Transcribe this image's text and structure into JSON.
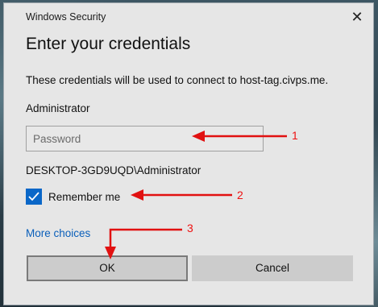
{
  "window": {
    "title": "Windows Security",
    "close_glyph": "✕"
  },
  "dialog": {
    "heading": "Enter your credentials",
    "info": "These credentials will be used to connect to host-tag.civps.me.",
    "username": "Administrator",
    "password_placeholder": "Password",
    "password_value": "",
    "domain_user": "DESKTOP-3GD9UQD\\Administrator",
    "remember_label": "Remember me",
    "remember_checked": true,
    "more_choices": "More choices",
    "ok_label": "OK",
    "cancel_label": "Cancel"
  },
  "annotations": {
    "labels": [
      "1",
      "2",
      "3"
    ],
    "color": "#e11111"
  },
  "colors": {
    "accent": "#0a67c8",
    "link": "#0a5fba",
    "dialog_bg": "#e6e6e6",
    "button_bg": "#cccccc"
  }
}
